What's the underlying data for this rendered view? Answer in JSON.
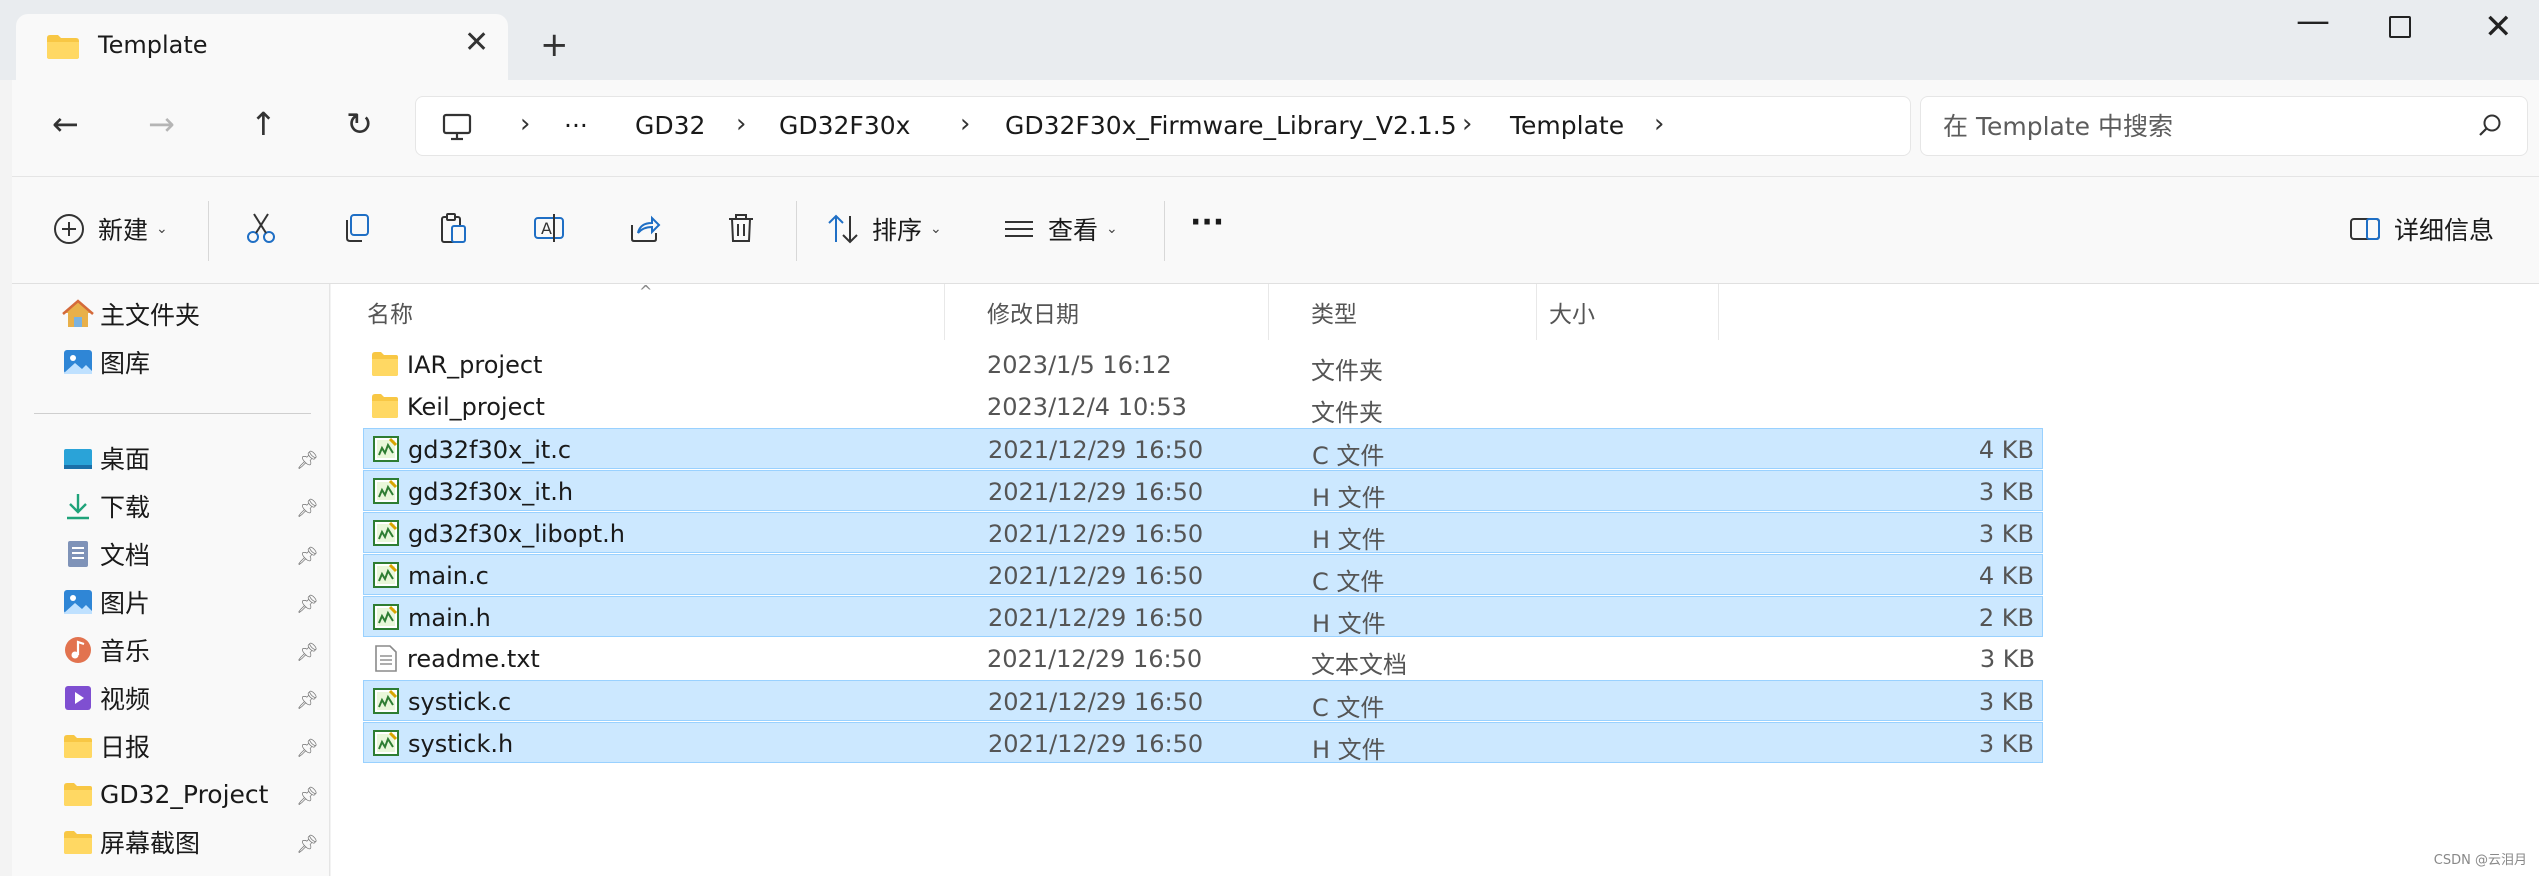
{
  "window": {
    "tab_title": "Template",
    "new_tab": "+",
    "minimize": "—",
    "close": "✕"
  },
  "nav": {
    "back": "←",
    "forward": "→",
    "up": "↑",
    "refresh": "↻",
    "breadcrumb": {
      "more": "···",
      "items": [
        "GD32",
        "GD32F30x",
        "GD32F30x_Firmware_Library_V2.1.5",
        "Template"
      ]
    },
    "search_placeholder": "在 Template 中搜索"
  },
  "toolbar": {
    "new_label": "新建",
    "sort_label": "排序",
    "view_label": "查看",
    "more": "···",
    "details_label": "详细信息"
  },
  "sidebar": {
    "top_items": [
      {
        "label": "主文件夹",
        "icon": "home-icon"
      },
      {
        "label": "图库",
        "icon": "gallery-icon"
      }
    ],
    "pinned_items": [
      {
        "label": "桌面",
        "icon": "desktop-icon"
      },
      {
        "label": "下载",
        "icon": "download-icon"
      },
      {
        "label": "文档",
        "icon": "document-icon"
      },
      {
        "label": "图片",
        "icon": "pictures-icon"
      },
      {
        "label": "音乐",
        "icon": "music-icon"
      },
      {
        "label": "视频",
        "icon": "video-icon"
      },
      {
        "label": "日报",
        "icon": "folder-icon"
      },
      {
        "label": "GD32_Project",
        "icon": "folder-icon"
      },
      {
        "label": "屏幕截图",
        "icon": "folder-icon"
      }
    ]
  },
  "columns": {
    "name": "名称",
    "date": "修改日期",
    "type": "类型",
    "size": "大小"
  },
  "files": [
    {
      "name": "IAR_project",
      "date": "2023/1/5 16:12",
      "type": "文件夹",
      "size": "",
      "kind": "folder",
      "selected": false
    },
    {
      "name": "Keil_project",
      "date": "2023/12/4 10:53",
      "type": "文件夹",
      "size": "",
      "kind": "folder",
      "selected": false
    },
    {
      "name": "gd32f30x_it.c",
      "date": "2021/12/29 16:50",
      "type": "C 文件",
      "size": "4 KB",
      "kind": "source",
      "selected": true
    },
    {
      "name": "gd32f30x_it.h",
      "date": "2021/12/29 16:50",
      "type": "H 文件",
      "size": "3 KB",
      "kind": "source",
      "selected": true
    },
    {
      "name": "gd32f30x_libopt.h",
      "date": "2021/12/29 16:50",
      "type": "H 文件",
      "size": "3 KB",
      "kind": "source",
      "selected": true
    },
    {
      "name": "main.c",
      "date": "2021/12/29 16:50",
      "type": "C 文件",
      "size": "4 KB",
      "kind": "source",
      "selected": true
    },
    {
      "name": "main.h",
      "date": "2021/12/29 16:50",
      "type": "H 文件",
      "size": "2 KB",
      "kind": "source",
      "selected": true
    },
    {
      "name": "readme.txt",
      "date": "2021/12/29 16:50",
      "type": "文本文档",
      "size": "3 KB",
      "kind": "text",
      "selected": false
    },
    {
      "name": "systick.c",
      "date": "2021/12/29 16:50",
      "type": "C 文件",
      "size": "3 KB",
      "kind": "source",
      "selected": true
    },
    {
      "name": "systick.h",
      "date": "2021/12/29 16:50",
      "type": "H 文件",
      "size": "3 KB",
      "kind": "source",
      "selected": true
    }
  ],
  "colors": {
    "selection_bg": "#cce8ff",
    "selection_border": "#99d1ff",
    "folder": "#f8c744"
  },
  "watermark": "CSDN @云泪月"
}
